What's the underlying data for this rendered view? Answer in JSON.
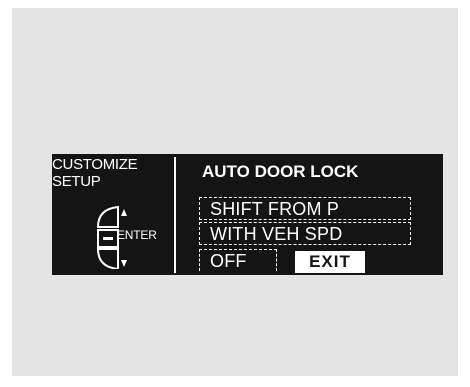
{
  "screen": {
    "left_label": "CUSTOMIZE\nSETUP",
    "enter_label": "ENTER",
    "title": "AUTO DOOR LOCK",
    "options": [
      {
        "label": "SHIFT FROM P"
      },
      {
        "label": "WITH VEH SPD"
      },
      {
        "label": "OFF"
      }
    ],
    "exit_label": "EXIT"
  },
  "icons": {
    "dial": "selector-dial-icon",
    "up": "arrow-up-icon",
    "down": "arrow-down-icon",
    "enter": "enter-button-icon"
  },
  "colors": {
    "background": "#e4e4e4",
    "screen": "#141414",
    "text": "#ffffff"
  }
}
